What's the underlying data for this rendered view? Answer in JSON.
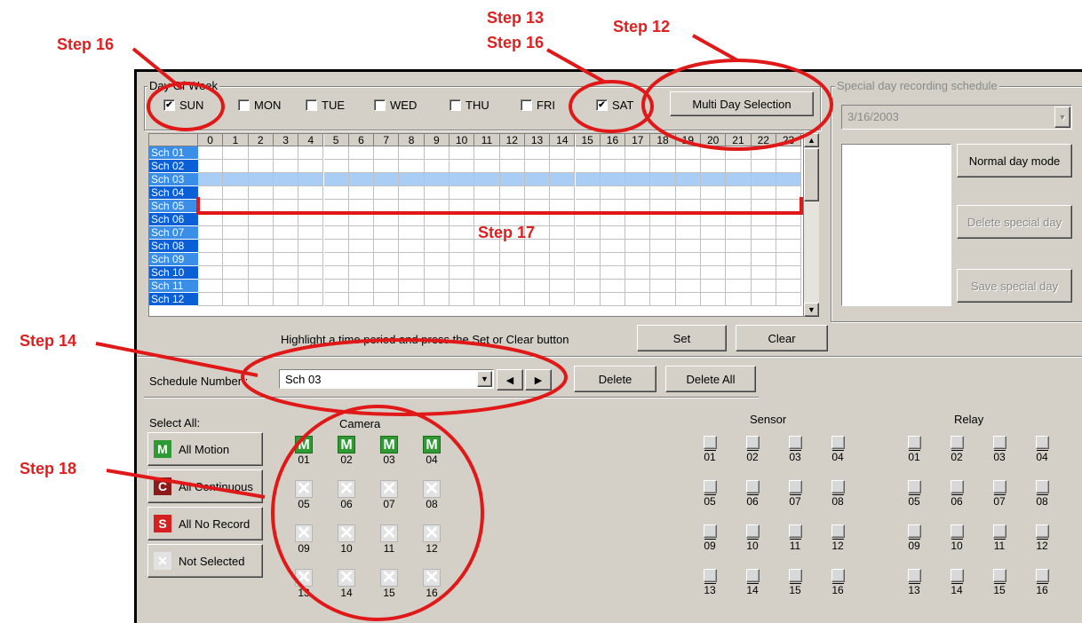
{
  "annotations": {
    "step16a": "Step 16",
    "step13": "Step 13",
    "step16b": "Step 16",
    "step12": "Step 12",
    "step14": "Step 14",
    "step17": "Step 17",
    "step18": "Step 18"
  },
  "dow": {
    "title": "Day Of Week",
    "days": [
      {
        "label": "SUN",
        "checked": true
      },
      {
        "label": "MON",
        "checked": false
      },
      {
        "label": "TUE",
        "checked": false
      },
      {
        "label": "WED",
        "checked": false
      },
      {
        "label": "THU",
        "checked": false
      },
      {
        "label": "FRI",
        "checked": false
      },
      {
        "label": "SAT",
        "checked": true
      }
    ],
    "multi_day_button": "Multi Day Selection"
  },
  "special": {
    "title": "Special day recording schedule",
    "date": "3/16/2003",
    "normal_mode": "Normal day mode",
    "delete_special": "Delete special day",
    "save_special": "Save special day"
  },
  "grid": {
    "hours": [
      "0",
      "1",
      "2",
      "3",
      "4",
      "5",
      "6",
      "7",
      "8",
      "9",
      "10",
      "11",
      "12",
      "13",
      "14",
      "15",
      "16",
      "17",
      "18",
      "19",
      "20",
      "21",
      "22",
      "23"
    ],
    "rows": [
      "Sch 01",
      "Sch 02",
      "Sch 03",
      "Sch 04",
      "Sch 05",
      "Sch 06",
      "Sch 07",
      "Sch 08",
      "Sch 09",
      "Sch 10",
      "Sch 11",
      "Sch 12"
    ],
    "selected_row": 2
  },
  "hint": "Highlight a time period and press the Set or Clear button",
  "set_label": "Set",
  "clear_label": "Clear",
  "schedule": {
    "label": "Schedule Number :",
    "value": "Sch 03",
    "delete": "Delete",
    "delete_all": "Delete All"
  },
  "select_all": {
    "label": "Select All:",
    "buttons": [
      {
        "icon": "M",
        "label": "All Motion",
        "color": "#2f9a34"
      },
      {
        "icon": "C",
        "label": "All Continuous",
        "color": "#8b1a1a"
      },
      {
        "icon": "S",
        "label": "All No Record",
        "color": "#d42020"
      },
      {
        "icon": "X",
        "label": "Not Selected",
        "color": "#e2e2e2"
      }
    ]
  },
  "camera": {
    "title": "Camera",
    "items": [
      {
        "n": "01",
        "s": "M"
      },
      {
        "n": "02",
        "s": "M"
      },
      {
        "n": "03",
        "s": "M"
      },
      {
        "n": "04",
        "s": "M"
      },
      {
        "n": "05",
        "s": "X"
      },
      {
        "n": "06",
        "s": "X"
      },
      {
        "n": "07",
        "s": "X"
      },
      {
        "n": "08",
        "s": "X"
      },
      {
        "n": "09",
        "s": "X"
      },
      {
        "n": "10",
        "s": "X"
      },
      {
        "n": "11",
        "s": "X"
      },
      {
        "n": "12",
        "s": "X"
      },
      {
        "n": "13",
        "s": "X"
      },
      {
        "n": "14",
        "s": "X"
      },
      {
        "n": "15",
        "s": "X"
      },
      {
        "n": "16",
        "s": "X"
      }
    ]
  },
  "sensor": {
    "title": "Sensor",
    "items": [
      "01",
      "02",
      "03",
      "04",
      "05",
      "06",
      "07",
      "08",
      "09",
      "10",
      "11",
      "12",
      "13",
      "14",
      "15",
      "16"
    ]
  },
  "relay": {
    "title": "Relay",
    "items": [
      "01",
      "02",
      "03",
      "04",
      "05",
      "06",
      "07",
      "08",
      "09",
      "10",
      "11",
      "12",
      "13",
      "14",
      "15",
      "16"
    ]
  }
}
